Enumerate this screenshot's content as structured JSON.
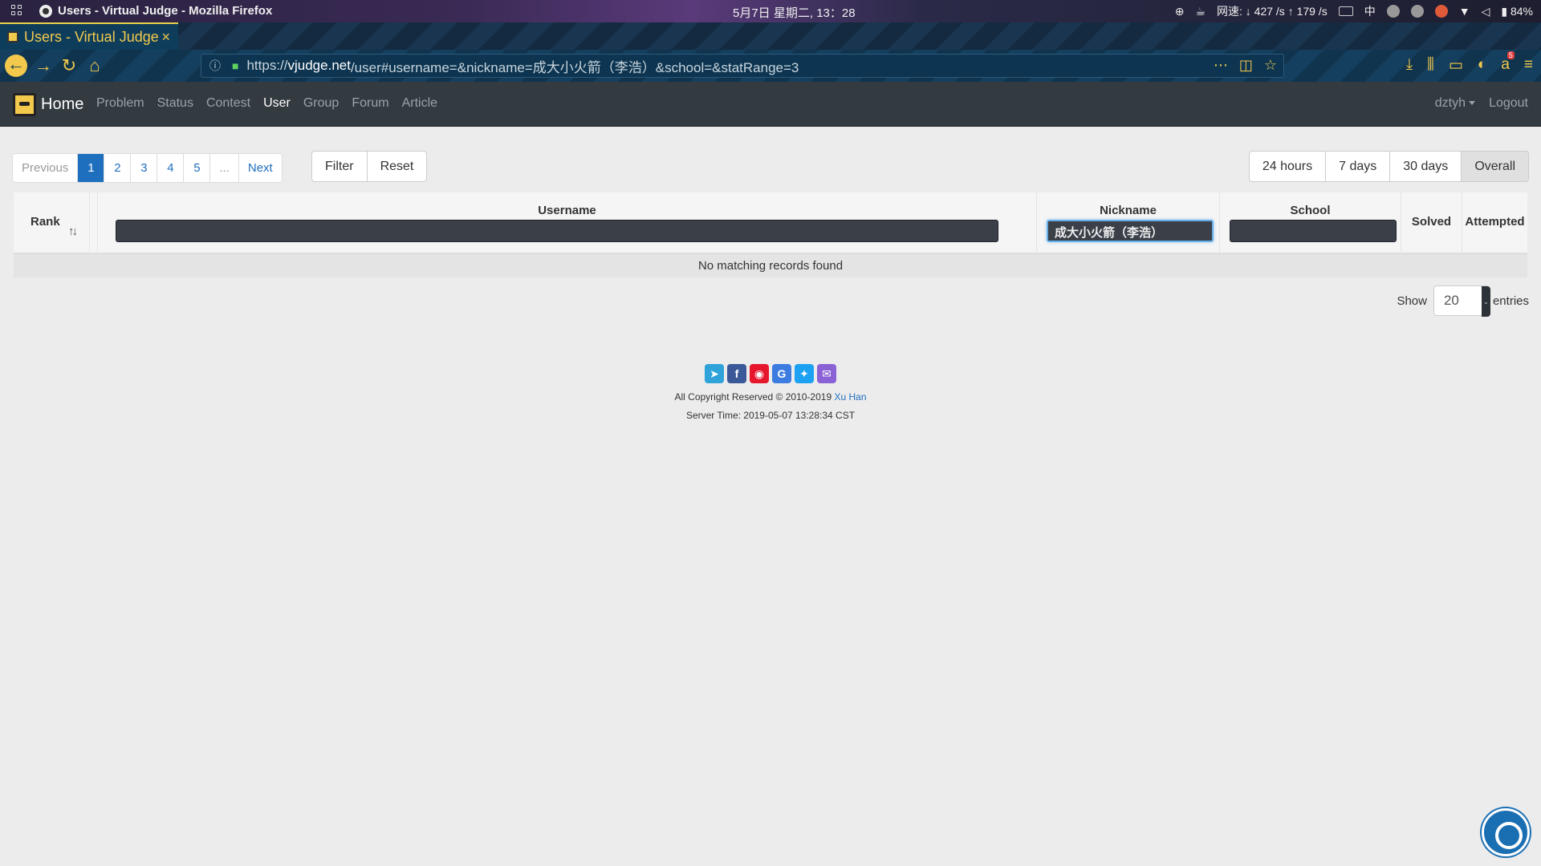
{
  "os": {
    "window_title": "Users - Virtual Judge - Mozilla Firefox",
    "clock": "5月7日 星期二, 13：28",
    "net_speed": "网速: ↓ 427 /s ↑ 179 /s",
    "ime": "中",
    "battery": "84%"
  },
  "browser": {
    "tab_title": "Users - Virtual Judge",
    "url_prefix": "https://",
    "url_host": "vjudge.net",
    "url_path": "/user#username=&nickname=成大小火箭（李浩）&school=&statRange=3",
    "downloads_badge": "5"
  },
  "site": {
    "brand": "Home",
    "menu": [
      "Problem",
      "Status",
      "Contest",
      "User",
      "Group",
      "Forum",
      "Article"
    ],
    "active_menu": "User",
    "username": "dztyh",
    "logout": "Logout"
  },
  "pagination": {
    "previous": "Previous",
    "pages": [
      "1",
      "2",
      "3",
      "4",
      "5"
    ],
    "ellipsis": "...",
    "next": "Next",
    "current": "1"
  },
  "actions": {
    "filter": "Filter",
    "reset": "Reset"
  },
  "ranges": [
    "24 hours",
    "7 days",
    "30 days",
    "Overall"
  ],
  "active_range": "Overall",
  "table": {
    "columns": {
      "rank": "Rank",
      "username": "Username",
      "nickname": "Nickname",
      "school": "School",
      "solved": "Solved",
      "attempted": "Attempted"
    },
    "filters": {
      "username": "",
      "nickname": "成大小火箭（李浩）",
      "school": ""
    },
    "empty_message": "No matching records found"
  },
  "page_size": {
    "label_before": "Show",
    "value": "20",
    "label_after": "entries"
  },
  "footer": {
    "share_icons": [
      "telegram-icon",
      "facebook-icon",
      "weibo-icon",
      "google-icon",
      "twitter-icon",
      "email-icon"
    ],
    "copyright": "All Copyright Reserved © 2010-2019",
    "author": "Xu Han",
    "server_time": "Server Time: 2019-05-07 13:28:34 CST"
  },
  "colors": {
    "accent": "#1f6fbf",
    "navbar": "#333a40",
    "firefox_theme": "#f2c94c"
  }
}
